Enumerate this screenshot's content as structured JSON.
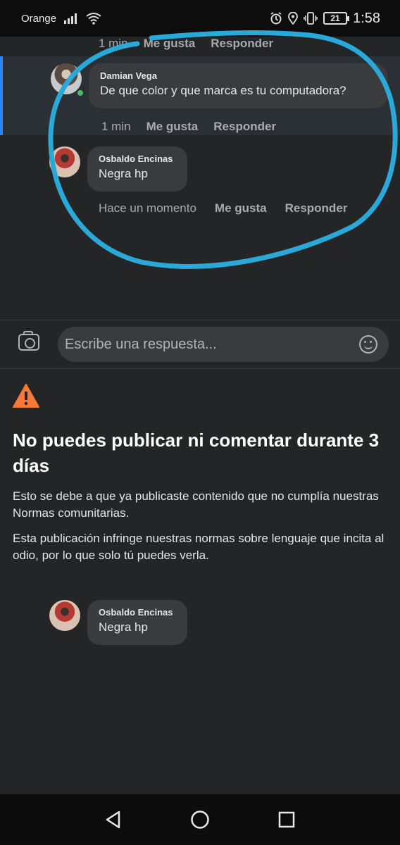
{
  "status_bar": {
    "carrier": "Orange",
    "battery": "21",
    "time": "1:58"
  },
  "comments": [
    {
      "time": "1 min",
      "like": "Me gusta",
      "reply": "Responder"
    },
    {
      "author": "Damian Vega",
      "text": "De que color y que marca es tu computadora?",
      "time": "1 min",
      "like": "Me gusta",
      "reply": "Responder"
    },
    {
      "author": "Osbaldo Encinas",
      "text": "Negra hp",
      "time": "Hace un momento",
      "like": "Me gusta",
      "reply": "Responder"
    }
  ],
  "reply_box": {
    "placeholder": "Escribe una respuesta..."
  },
  "restriction_notice": {
    "title": "No puedes publicar ni comentar durante 3 días",
    "paragraph1": "Esto se debe a que ya publicaste contenido que no cumplía nuestras Normas comunitarias.",
    "paragraph2": "Esta publicación infringe nuestras normas sobre lenguaje que incita al odio, por lo que solo tú puedes verla."
  },
  "flagged_comment": {
    "author": "Osbaldo Encinas",
    "text": "Negra hp"
  },
  "colors": {
    "annotation_circle": "#2aa8d8",
    "warning": "#f5793a",
    "online": "#45bd62"
  },
  "icons": [
    "wifi-icon",
    "signal-icon",
    "alarm-icon",
    "location-icon",
    "vibrate-icon",
    "camera-icon",
    "smiley-icon",
    "warning-icon",
    "back-icon",
    "home-icon",
    "recents-icon"
  ]
}
